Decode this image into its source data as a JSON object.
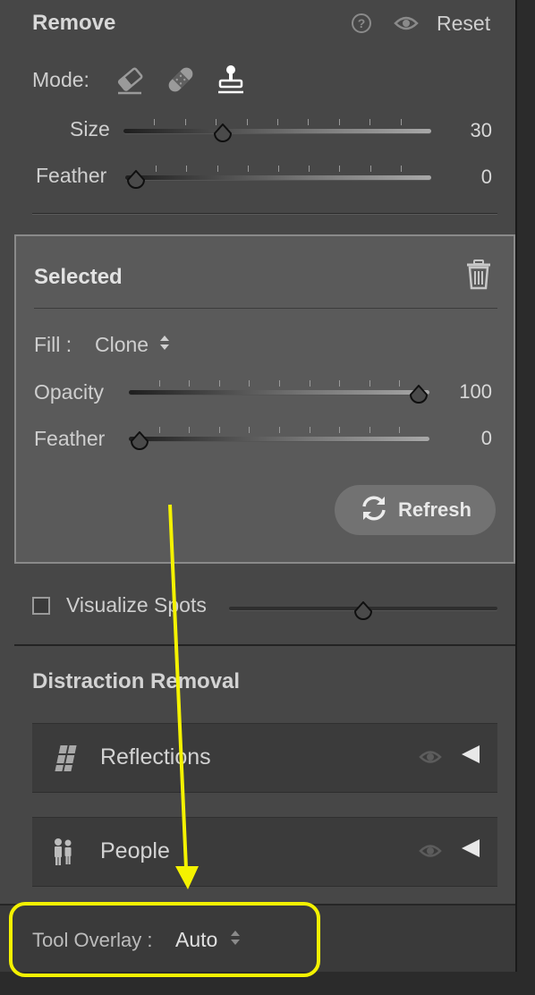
{
  "remove": {
    "title": "Remove",
    "help_glyph": "?",
    "reset_label": "Reset",
    "mode_label": "Mode:",
    "mode_icons": [
      "eraser-icon",
      "bandage-icon",
      "clone-stamp-icon"
    ],
    "size_label": "Size",
    "size_value": "30",
    "size_level": 0.31,
    "feather_label": "Feather",
    "feather_value": "0",
    "feather_level": 0.0
  },
  "selected": {
    "title": "Selected",
    "fill_label": "Fill :",
    "fill_value": "Clone",
    "opacity_label": "Opacity",
    "opacity_value": "100",
    "opacity_level": 1.0,
    "feather_label": "Feather",
    "feather_value": "0",
    "feather_level": 0.0,
    "refresh_label": "Refresh"
  },
  "visualize": {
    "label": "Visualize Spots",
    "checked": false,
    "level": 0.5
  },
  "distraction": {
    "title": "Distraction Removal",
    "items": [
      {
        "label": "Reflections",
        "icon": "reflections-icon"
      },
      {
        "label": "People",
        "icon": "people-icon"
      }
    ]
  },
  "tool_overlay": {
    "label": "Tool Overlay :",
    "value": "Auto"
  },
  "annotation": {
    "color": "#f4f200"
  }
}
